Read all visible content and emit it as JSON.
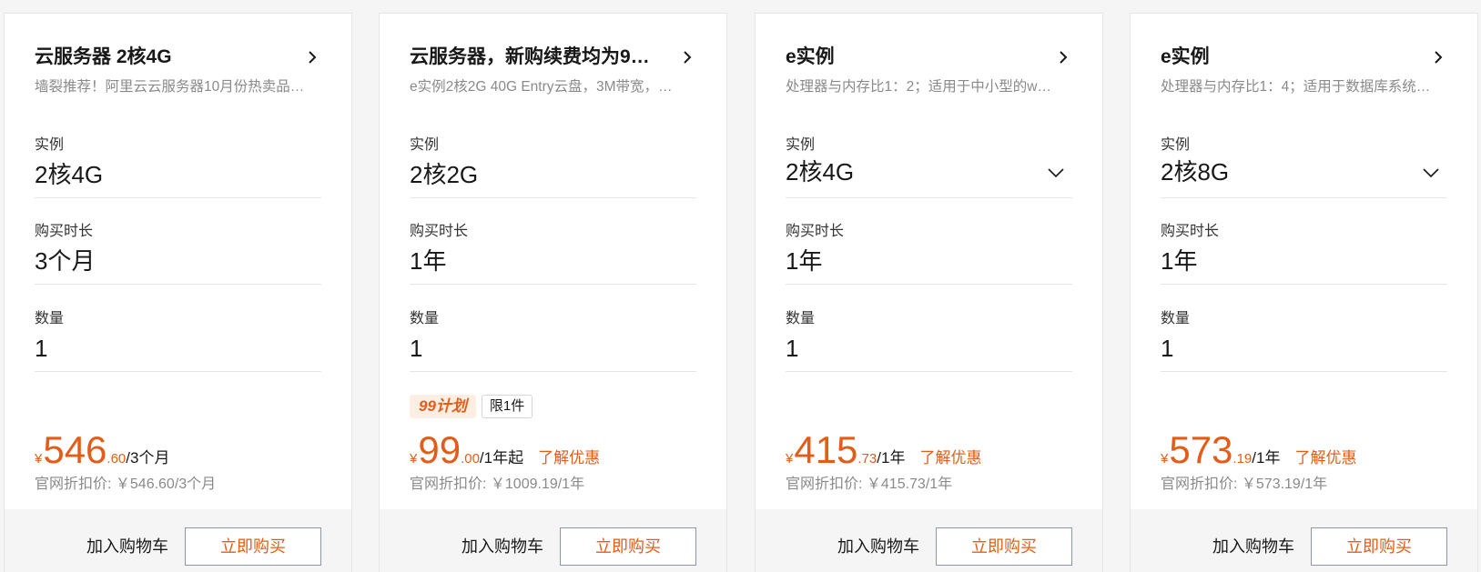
{
  "colors": {
    "accent": "#e35d19",
    "text": "#181818",
    "muted": "#8a8a8a",
    "border": "#e5e5e5",
    "footer_bg": "#f5f5f6"
  },
  "cards": [
    {
      "title": "云服务器 2核4G",
      "subtitle": "墙裂推荐！阿里云云服务器10月份热卖品…",
      "fields": [
        {
          "label": "实例",
          "value": "2核4G"
        },
        {
          "label": "购买时长",
          "value": "3个月"
        },
        {
          "label": "数量",
          "value": "1"
        }
      ],
      "price": {
        "currency": "¥",
        "int": "546",
        "dec": ".60",
        "unit": "/3个月"
      },
      "original": "官网折扣价: ￥546.60/3个月",
      "cart_label": "加入购物车",
      "buy_label": "立即购买"
    },
    {
      "title": "云服务器，新购续费均为9…",
      "subtitle": "e实例2核2G 40G Entry云盘，3M带宽，…",
      "fields": [
        {
          "label": "实例",
          "value": "2核2G"
        },
        {
          "label": "购买时长",
          "value": "1年"
        },
        {
          "label": "数量",
          "value": "1"
        }
      ],
      "tags": {
        "plan": "99计划",
        "limit": "限1件"
      },
      "price": {
        "currency": "¥",
        "int": "99",
        "dec": ".00",
        "unit": "/1年起"
      },
      "learn_more": "了解优惠",
      "original": "官网折扣价: ￥1009.19/1年",
      "cart_label": "加入购物车",
      "buy_label": "立即购买"
    },
    {
      "title": "e实例",
      "subtitle": "处理器与内存比1：2；适用于中小型的w…",
      "fields": [
        {
          "label": "实例",
          "value": "2核4G"
        },
        {
          "label": "购买时长",
          "value": "1年"
        },
        {
          "label": "数量",
          "value": "1"
        }
      ],
      "price": {
        "currency": "¥",
        "int": "415",
        "dec": ".73",
        "unit": "/1年"
      },
      "learn_more": "了解优惠",
      "original": "官网折扣价: ￥415.73/1年",
      "cart_label": "加入购物车",
      "buy_label": "立即购买"
    },
    {
      "title": "e实例",
      "subtitle": "处理器与内存比1：4；适用于数据库系统…",
      "fields": [
        {
          "label": "实例",
          "value": "2核8G"
        },
        {
          "label": "购买时长",
          "value": "1年"
        },
        {
          "label": "数量",
          "value": "1"
        }
      ],
      "price": {
        "currency": "¥",
        "int": "573",
        "dec": ".19",
        "unit": "/1年"
      },
      "learn_more": "了解优惠",
      "original": "官网折扣价: ￥573.19/1年",
      "cart_label": "加入购物车",
      "buy_label": "立即购买"
    }
  ]
}
